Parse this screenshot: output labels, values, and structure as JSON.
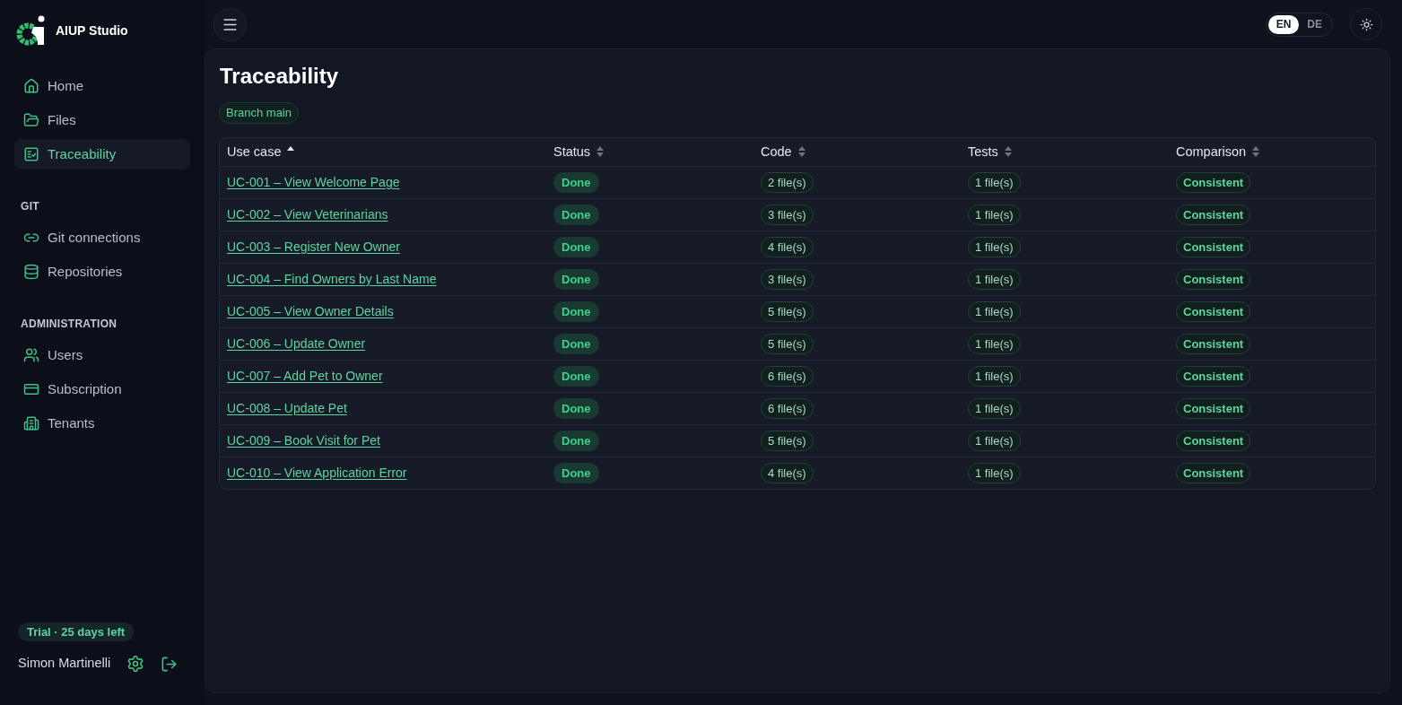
{
  "app": {
    "name": "AIUP Studio"
  },
  "sidebar": {
    "sections": [
      {
        "items": [
          {
            "label": "Home",
            "selected": false
          },
          {
            "label": "Files",
            "selected": false
          },
          {
            "label": "Traceability",
            "selected": true
          }
        ]
      },
      {
        "heading": "GIT",
        "items": [
          {
            "label": "Git connections",
            "selected": false
          },
          {
            "label": "Repositories",
            "selected": false
          }
        ]
      },
      {
        "heading": "ADMINISTRATION",
        "items": [
          {
            "label": "Users",
            "selected": false
          },
          {
            "label": "Subscription",
            "selected": false
          },
          {
            "label": "Tenants",
            "selected": false
          }
        ]
      }
    ],
    "trial_badge": "Trial · 25 days left",
    "user": {
      "name": "Simon Martinelli"
    }
  },
  "topbar": {
    "languages": [
      {
        "label": "EN",
        "selected": true
      },
      {
        "label": "DE",
        "selected": false
      }
    ]
  },
  "page": {
    "title": "Traceability",
    "branch_badge": "Branch main",
    "table": {
      "columns": [
        {
          "label": "Use case",
          "sorted": true
        },
        {
          "label": "Status",
          "sorted": false
        },
        {
          "label": "Code",
          "sorted": false
        },
        {
          "label": "Tests",
          "sorted": false
        },
        {
          "label": "Comparison",
          "sorted": false
        }
      ],
      "rows": [
        {
          "use_case": "UC-001 – View Welcome Page",
          "status": "Done",
          "code": "2 file(s)",
          "tests": "1 file(s)",
          "comparison": "Consistent"
        },
        {
          "use_case": "UC-002 – View Veterinarians",
          "status": "Done",
          "code": "3 file(s)",
          "tests": "1 file(s)",
          "comparison": "Consistent"
        },
        {
          "use_case": "UC-003 – Register New Owner",
          "status": "Done",
          "code": "4 file(s)",
          "tests": "1 file(s)",
          "comparison": "Consistent"
        },
        {
          "use_case": "UC-004 – Find Owners by Last Name",
          "status": "Done",
          "code": "3 file(s)",
          "tests": "1 file(s)",
          "comparison": "Consistent"
        },
        {
          "use_case": "UC-005 – View Owner Details",
          "status": "Done",
          "code": "5 file(s)",
          "tests": "1 file(s)",
          "comparison": "Consistent"
        },
        {
          "use_case": "UC-006 – Update Owner",
          "status": "Done",
          "code": "5 file(s)",
          "tests": "1 file(s)",
          "comparison": "Consistent"
        },
        {
          "use_case": "UC-007 – Add Pet to Owner",
          "status": "Done",
          "code": "6 file(s)",
          "tests": "1 file(s)",
          "comparison": "Consistent"
        },
        {
          "use_case": "UC-008 – Update Pet",
          "status": "Done",
          "code": "6 file(s)",
          "tests": "1 file(s)",
          "comparison": "Consistent"
        },
        {
          "use_case": "UC-009 – Book Visit for Pet",
          "status": "Done",
          "code": "5 file(s)",
          "tests": "1 file(s)",
          "comparison": "Consistent"
        },
        {
          "use_case": "UC-010 – View Application Error",
          "status": "Done",
          "code": "4 file(s)",
          "tests": "1 file(s)",
          "comparison": "Consistent"
        }
      ]
    }
  }
}
